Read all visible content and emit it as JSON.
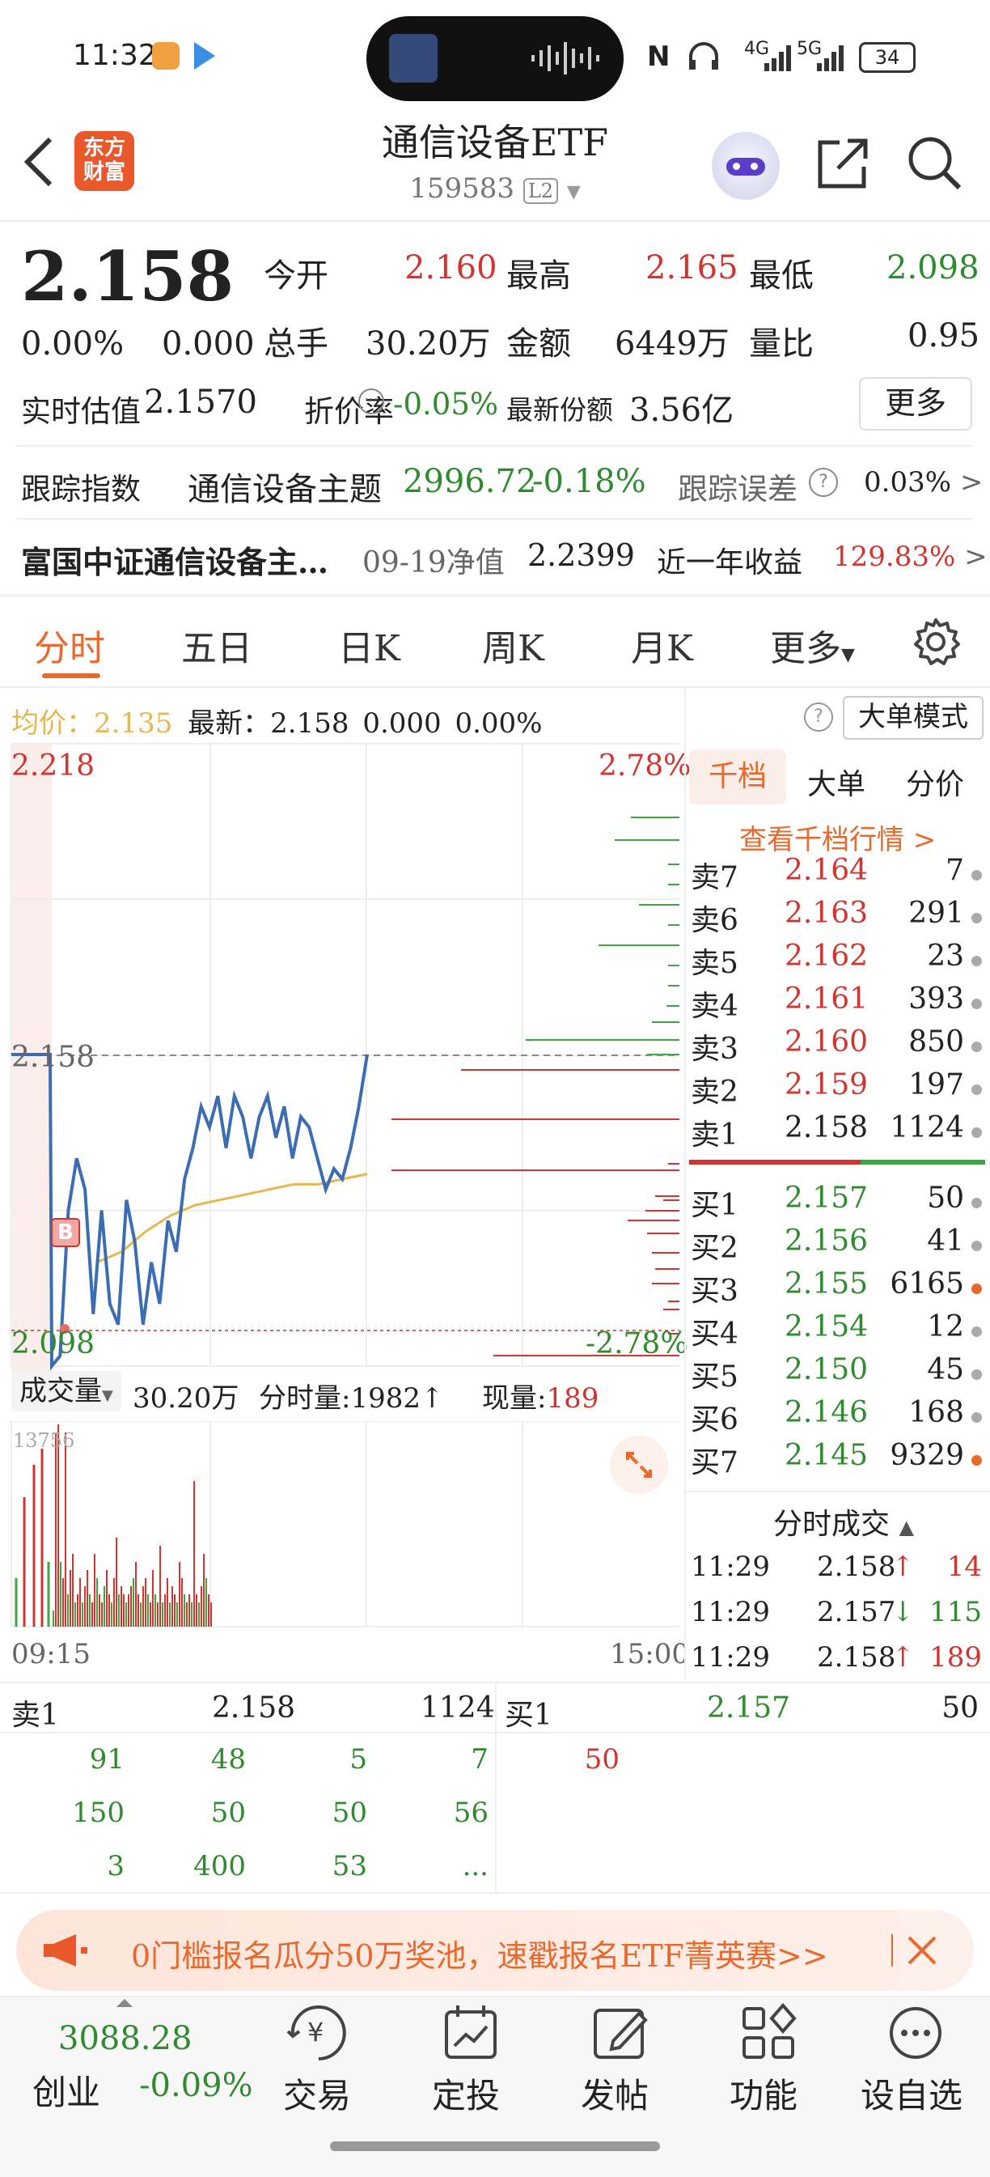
{
  "status_bar": {
    "time": "11:32",
    "network_1": "4G",
    "network_2": "5G",
    "battery": "34"
  },
  "header": {
    "brand_line1": "东方",
    "brand_line2": "财富",
    "title": "通信设备ETF",
    "code": "159583",
    "level": "L2"
  },
  "quote": {
    "price": "2.158",
    "change_pct": "0.00%",
    "change": "0.000",
    "open_label": "今开",
    "open": "2.160",
    "high_label": "最高",
    "high": "2.165",
    "low_label": "最低",
    "low": "2.098",
    "volume_label": "总手",
    "volume": "30.20万",
    "amount_label": "金额",
    "amount": "6449万",
    "ratio_label": "量比",
    "ratio": "0.95",
    "iopv_label": "实时估值",
    "iopv": "2.1570",
    "discount_label": "折价率",
    "discount": "-0.05%",
    "shares_label": "最新份额",
    "shares": "3.56亿",
    "more_label": "更多"
  },
  "tracking": {
    "index_label": "跟踪指数",
    "index_name": "通信设备主题",
    "index_value": "2996.72",
    "index_change": "-0.18%",
    "error_label": "跟踪误差",
    "error_value": "0.03%",
    "fund_name": "富国中证通信设备主…",
    "nav_label": "09-19净值",
    "nav": "2.2399",
    "year_label": "近一年收益",
    "year_return": "129.83%"
  },
  "tabs": [
    "分时",
    "五日",
    "日K",
    "周K",
    "月K",
    "更多"
  ],
  "chart_header": {
    "avg_label": "均价：",
    "avg": "2.135",
    "latest_label": "最新：",
    "latest": "2.158",
    "chg": "0.000",
    "pct": "0.00%",
    "mode_label": "大单模式"
  },
  "chart_labels": {
    "top_price": "2.218",
    "top_pct": "2.78%",
    "mid_price": "2.158",
    "bottom_price": "2.098",
    "bottom_pct": "-2.78%",
    "marker": "B"
  },
  "volume_header": {
    "label": "成交量",
    "total": "30.20万",
    "minute_label": "分时量:",
    "minute": "1982",
    "now_label": "现量:",
    "now": "189",
    "max": "13756",
    "time_start": "09:15",
    "time_end": "15:00"
  },
  "orderbook": {
    "tabs": [
      "千档",
      "大单",
      "分价"
    ],
    "link": "查看千档行情 >",
    "asks": [
      {
        "label": "卖7",
        "price": "2.164",
        "vol": "7"
      },
      {
        "label": "卖6",
        "price": "2.163",
        "vol": "291"
      },
      {
        "label": "卖5",
        "price": "2.162",
        "vol": "23"
      },
      {
        "label": "卖4",
        "price": "2.161",
        "vol": "393"
      },
      {
        "label": "卖3",
        "price": "2.160",
        "vol": "850"
      },
      {
        "label": "卖2",
        "price": "2.159",
        "vol": "197"
      },
      {
        "label": "卖1",
        "price": "2.158",
        "vol": "1124"
      }
    ],
    "bids": [
      {
        "label": "买1",
        "price": "2.157",
        "vol": "50"
      },
      {
        "label": "买2",
        "price": "2.156",
        "vol": "41"
      },
      {
        "label": "买3",
        "price": "2.155",
        "vol": "6165"
      },
      {
        "label": "买4",
        "price": "2.154",
        "vol": "12"
      },
      {
        "label": "买5",
        "price": "2.150",
        "vol": "45"
      },
      {
        "label": "买6",
        "price": "2.146",
        "vol": "168"
      },
      {
        "label": "买7",
        "price": "2.145",
        "vol": "9329"
      }
    ]
  },
  "ticks": {
    "title": "分时成交",
    "rows": [
      {
        "time": "11:29",
        "price": "2.158",
        "dir": "↑",
        "vol": "14"
      },
      {
        "time": "11:29",
        "price": "2.157",
        "dir": "↓",
        "vol": "115"
      },
      {
        "time": "11:29",
        "price": "2.158",
        "dir": "↑",
        "vol": "189"
      }
    ]
  },
  "queue": {
    "ask_label": "卖1",
    "ask_price": "2.158",
    "ask_vol": "1124",
    "bid_label": "买1",
    "bid_price": "2.157",
    "bid_vol": "50",
    "ask_rows": [
      [
        "91",
        "48",
        "5",
        "7"
      ],
      [
        "150",
        "50",
        "50",
        "56"
      ],
      [
        "3",
        "400",
        "53",
        "..."
      ]
    ],
    "bid_rows": [
      [
        "50"
      ]
    ]
  },
  "banner": {
    "text": "0门槛报名瓜分50万奖池，速戳报名ETF菁英赛>>"
  },
  "bottom_nav": {
    "index_value": "3088.28",
    "index_name": "创业",
    "index_change": "-0.09%",
    "items": [
      "交易",
      "定投",
      "发帖",
      "功能",
      "设自选"
    ]
  },
  "colors": {
    "up": "#d0352f",
    "down": "#2e8b2e",
    "accent": "#e8692d",
    "price_line": "#3b6db3",
    "avg_line": "#e8b650"
  }
}
